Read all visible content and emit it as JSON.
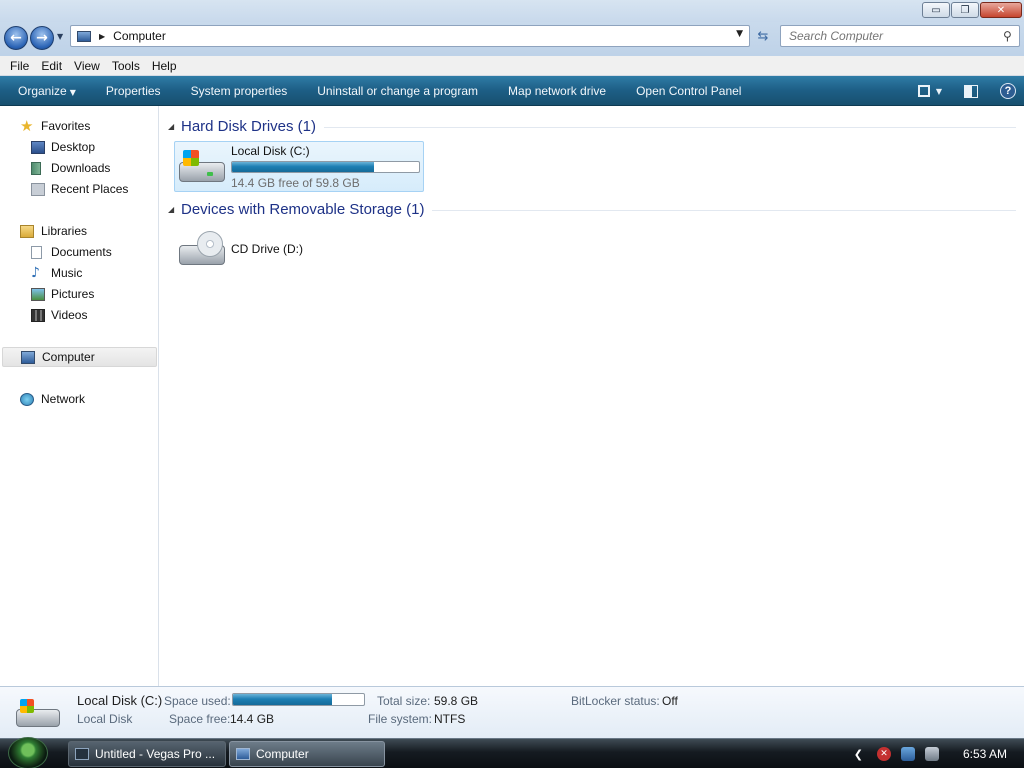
{
  "window": {
    "controls": {
      "minimize": "▭",
      "maximize": "❐",
      "close": "✕"
    }
  },
  "address_bar": {
    "breadcrumb": "Computer",
    "search_placeholder": "Search Computer"
  },
  "menu": [
    "File",
    "Edit",
    "View",
    "Tools",
    "Help"
  ],
  "command_bar": {
    "organize": "Organize",
    "items": [
      "Properties",
      "System properties",
      "Uninstall or change a program",
      "Map network drive",
      "Open Control Panel"
    ]
  },
  "nav_pane": {
    "favorites": {
      "label": "Favorites",
      "items": [
        "Desktop",
        "Downloads",
        "Recent Places"
      ]
    },
    "libraries": {
      "label": "Libraries",
      "items": [
        "Documents",
        "Music",
        "Pictures",
        "Videos"
      ]
    },
    "computer": "Computer",
    "network": "Network"
  },
  "groups": [
    {
      "title": "Hard Disk Drives (1)",
      "drives": [
        {
          "name": "Local Disk (C:)",
          "free_text": "14.4 GB free of 59.8 GB",
          "used_fraction": 0.759
        }
      ]
    },
    {
      "title": "Devices with Removable Storage (1)",
      "drives": [
        {
          "name": "CD Drive (D:)"
        }
      ]
    }
  ],
  "details_pane": {
    "name": "Local Disk (C:)",
    "type": "Local Disk",
    "space_used_label": "Space used:",
    "used_fraction": 0.759,
    "space_free_label": "Space free:",
    "space_free": "14.4 GB",
    "total_size_label": "Total size:",
    "total_size": "59.8 GB",
    "file_system_label": "File system:",
    "file_system": "NTFS",
    "bitlocker_label": "BitLocker status:",
    "bitlocker": "Off"
  },
  "taskbar": {
    "buttons": [
      "Untitled - Vegas Pro ...",
      "Computer"
    ],
    "clock": "6:53 AM"
  },
  "colors": {
    "command_bar": "#1d5e85",
    "group_title": "#1e3287",
    "selection": "#d6ecfb",
    "usage_bar": "#1d7fb4"
  }
}
